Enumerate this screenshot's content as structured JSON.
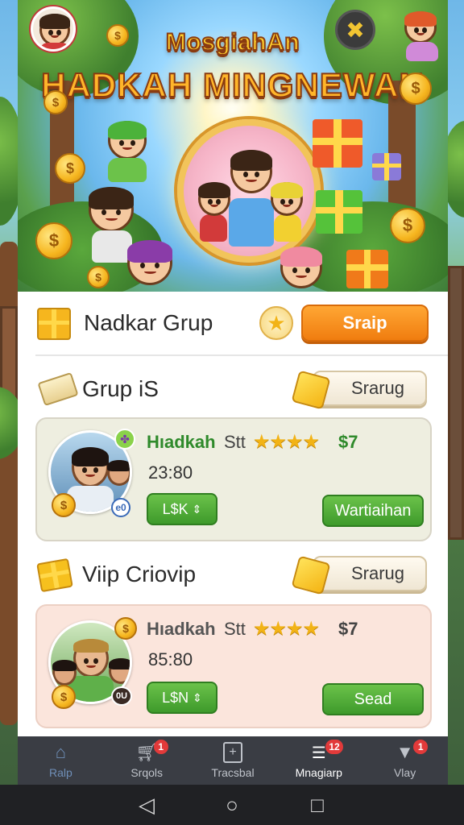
{
  "banner": {
    "title_line1": "MosgiahAn",
    "title_line2": "HADKAH MINGNEWAN"
  },
  "close_icon": "close-icon",
  "sections": [
    {
      "title": "Nadkar Grup",
      "button": "Sraip",
      "icon": "gift-icon"
    },
    {
      "title": "Grup iS",
      "button": "Srarug",
      "icon": "ticket-icon"
    },
    {
      "title": "Viip Criovip",
      "button": "Srarug",
      "icon": "gift-icon"
    }
  ],
  "cards": [
    {
      "name": "Hıadkah",
      "suffix": "Stt",
      "rating": 4,
      "price": "$7",
      "time": "23:80",
      "code_label": "L$K",
      "action": "Wartiaihan",
      "badge": "e0",
      "accent": "#2f8a2b"
    },
    {
      "name": "Hıadkah",
      "suffix": "Stt",
      "rating": 4,
      "price": "$7",
      "time": "85:80",
      "code_label": "L$N",
      "action": "Sead",
      "badge": "0U",
      "accent": "#555555"
    }
  ],
  "tabs": [
    {
      "label": "Ralp",
      "icon": "home-icon",
      "badge": ""
    },
    {
      "label": "Srqols",
      "icon": "cart-icon",
      "badge": "1"
    },
    {
      "label": "Tracsbal",
      "icon": "clipboard-icon",
      "badge": ""
    },
    {
      "label": "Mnagiarp",
      "icon": "document-icon",
      "badge": "12"
    },
    {
      "label": "Vlay",
      "icon": "shield-icon",
      "badge": "1"
    }
  ],
  "active_tab": 3,
  "colors": {
    "accent_orange": "#f08a18",
    "accent_green": "#3e9a2b",
    "tabbar": "#3a3d44"
  }
}
